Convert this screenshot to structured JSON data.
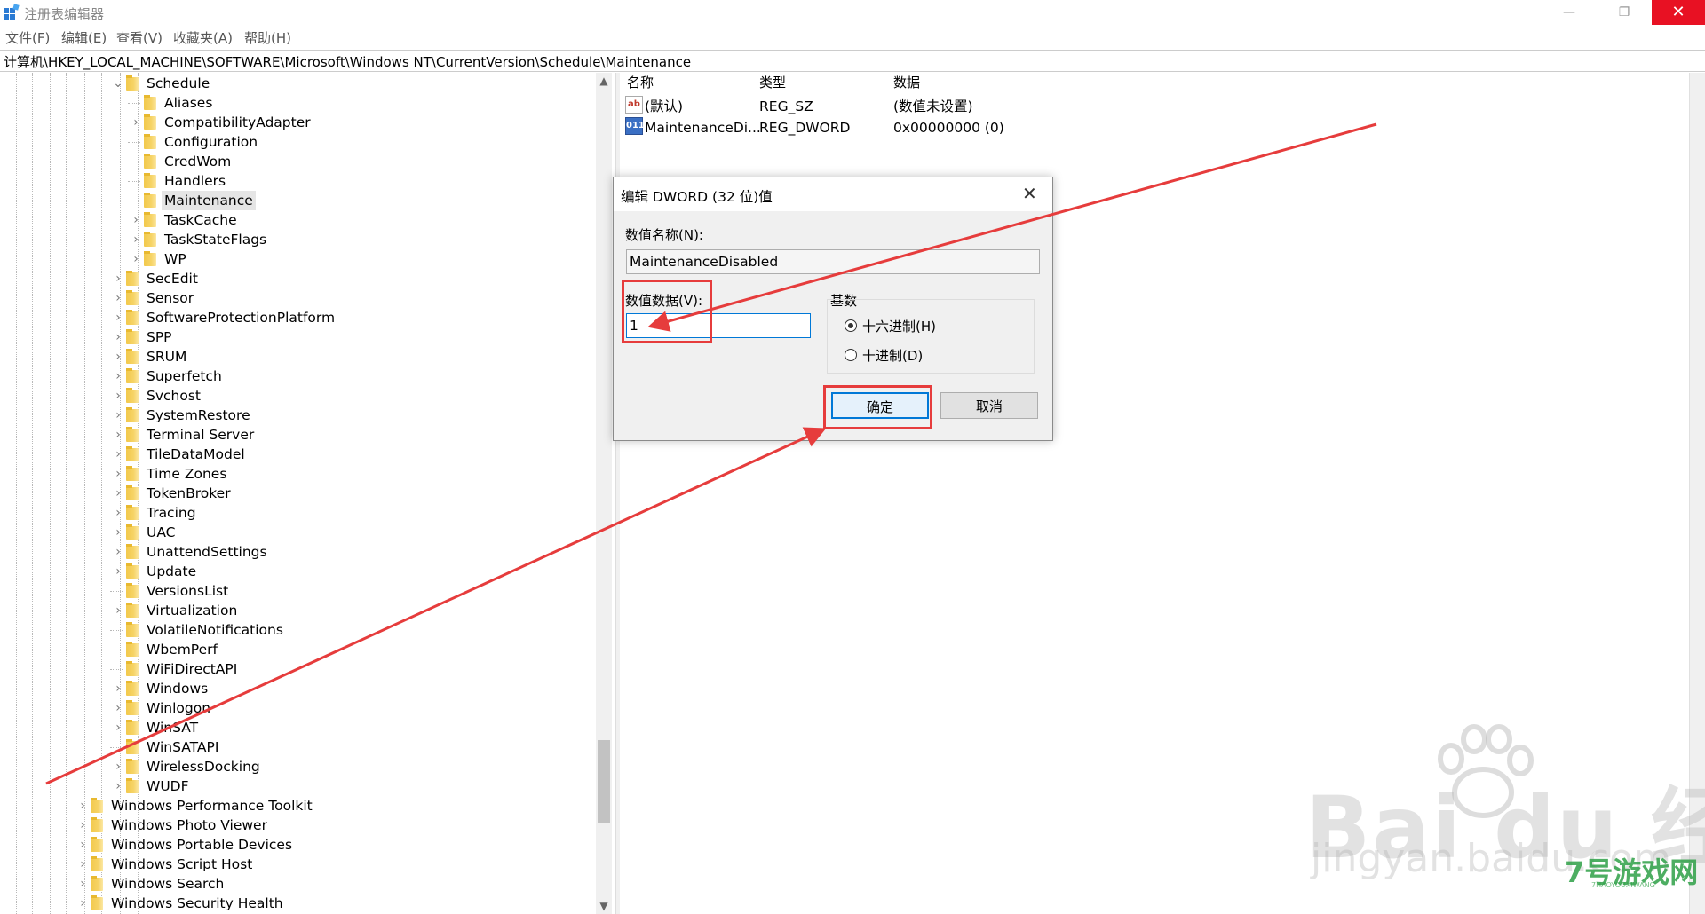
{
  "window": {
    "title": "注册表编辑器",
    "close_glyph": "✕",
    "min_glyph": "—",
    "max_glyph": "❐"
  },
  "menu": [
    "文件(F)",
    "编辑(E)",
    "查看(V)",
    "收藏夹(A)",
    "帮助(H)"
  ],
  "address": "计算机\\HKEY_LOCAL_MACHINE\\SOFTWARE\\Microsoft\\Windows NT\\CurrentVersion\\Schedule\\Maintenance",
  "tree": {
    "schedule": "Schedule",
    "schedule_children": [
      {
        "label": "Aliases",
        "expandable": false
      },
      {
        "label": "CompatibilityAdapter",
        "expandable": true
      },
      {
        "label": "Configuration",
        "expandable": false
      },
      {
        "label": "CredWom",
        "expandable": false
      },
      {
        "label": "Handlers",
        "expandable": false
      },
      {
        "label": "Maintenance",
        "expandable": false,
        "selected": true
      },
      {
        "label": "TaskCache",
        "expandable": true
      },
      {
        "label": "TaskStateFlags",
        "expandable": true
      },
      {
        "label": "WP",
        "expandable": true
      }
    ],
    "level2": [
      {
        "label": "SecEdit",
        "expandable": true
      },
      {
        "label": "Sensor",
        "expandable": true
      },
      {
        "label": "SoftwareProtectionPlatform",
        "expandable": true
      },
      {
        "label": "SPP",
        "expandable": true
      },
      {
        "label": "SRUM",
        "expandable": true
      },
      {
        "label": "Superfetch",
        "expandable": true
      },
      {
        "label": "Svchost",
        "expandable": true
      },
      {
        "label": "SystemRestore",
        "expandable": true
      },
      {
        "label": "Terminal Server",
        "expandable": true
      },
      {
        "label": "TileDataModel",
        "expandable": true
      },
      {
        "label": "Time Zones",
        "expandable": true
      },
      {
        "label": "TokenBroker",
        "expandable": true
      },
      {
        "label": "Tracing",
        "expandable": true
      },
      {
        "label": "UAC",
        "expandable": true
      },
      {
        "label": "UnattendSettings",
        "expandable": true
      },
      {
        "label": "Update",
        "expandable": true
      },
      {
        "label": "VersionsList",
        "expandable": false
      },
      {
        "label": "Virtualization",
        "expandable": true
      },
      {
        "label": "VolatileNotifications",
        "expandable": false
      },
      {
        "label": "WbemPerf",
        "expandable": false
      },
      {
        "label": "WiFiDirectAPI",
        "expandable": false
      },
      {
        "label": "Windows",
        "expandable": true
      },
      {
        "label": "Winlogon",
        "expandable": true
      },
      {
        "label": "WinSAT",
        "expandable": true
      },
      {
        "label": "WinSATAPI",
        "expandable": false
      },
      {
        "label": "WirelessDocking",
        "expandable": true
      },
      {
        "label": "WUDF",
        "expandable": true
      }
    ],
    "level1": [
      {
        "label": "Windows Performance Toolkit",
        "expandable": true
      },
      {
        "label": "Windows Photo Viewer",
        "expandable": true
      },
      {
        "label": "Windows Portable Devices",
        "expandable": true
      },
      {
        "label": "Windows Script Host",
        "expandable": true
      },
      {
        "label": "Windows Search",
        "expandable": true
      },
      {
        "label": "Windows Security Health",
        "expandable": true
      }
    ]
  },
  "list": {
    "columns": {
      "name": "名称",
      "type": "类型",
      "data": "数据"
    },
    "rows": [
      {
        "icon": "string-value-icon",
        "icon_text": "ab",
        "name": "(默认)",
        "type": "REG_SZ",
        "data": "(数值未设置)"
      },
      {
        "icon": "dword-value-icon",
        "icon_text": "011",
        "name": "MaintenanceDi...",
        "type": "REG_DWORD",
        "data": "0x00000000 (0)"
      }
    ]
  },
  "dialog": {
    "title": "编辑 DWORD (32 位)值",
    "value_name_label": "数值名称(N):",
    "value_name": "MaintenanceDisabled",
    "value_data_label": "数值数据(V):",
    "value_data": "1",
    "base_label": "基数",
    "hex_label": "十六进制(H)",
    "dec_label": "十进制(D)",
    "hex_selected": true,
    "ok_label": "确定",
    "cancel_label": "取消"
  },
  "annotation_color": "#e63c3c",
  "watermark": {
    "baidu": "Bai du 经验",
    "jingyan": "jingyan.baidu.com",
    "site": "7号游戏网",
    "site_sub": "7HAOYOUXIWANG"
  }
}
